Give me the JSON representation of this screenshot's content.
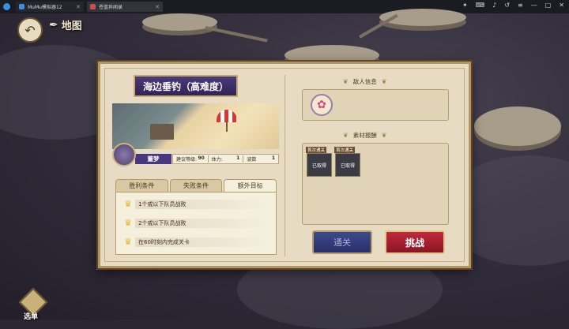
{
  "emulator": {
    "tab1_title": "MuMu模拟器12",
    "tab2_title": "苍蓝异闻录"
  },
  "hud": {
    "map_label": "地图",
    "select_label": "选单"
  },
  "stage": {
    "title": "海边垂钓（高难度）",
    "boss_name": "董梦",
    "stats": [
      {
        "label": "建议等级:",
        "value": "90"
      },
      {
        "label": "体力:",
        "value": "1"
      },
      {
        "label": "波数",
        "value": "1"
      }
    ]
  },
  "tabs": [
    {
      "label": "胜利条件",
      "active": false
    },
    {
      "label": "失败条件",
      "active": false
    },
    {
      "label": "额外目标",
      "active": true
    }
  ],
  "conditions": [
    "1个或以下队员战败",
    "2个或以下队员战败",
    "在60时刻内完成关卡"
  ],
  "enemy_section": {
    "title": "敌人信息"
  },
  "reward_section": {
    "title": "素材报酬",
    "items": [
      {
        "tag": "首次通关",
        "status": "已取得"
      },
      {
        "tag": "首次通关",
        "status": "已取得"
      }
    ]
  },
  "buttons": {
    "clear": "通关",
    "fight": "挑战"
  },
  "icons": {
    "back": "back-arrow-icon",
    "quill": "quill-icon",
    "crown": "crown-icon",
    "fish": "fish-icon"
  },
  "colors": {
    "banner": "#3c2f6a",
    "fight_button": "#a8202f",
    "clear_button": "#323c7a",
    "crown": "#e3b832"
  }
}
